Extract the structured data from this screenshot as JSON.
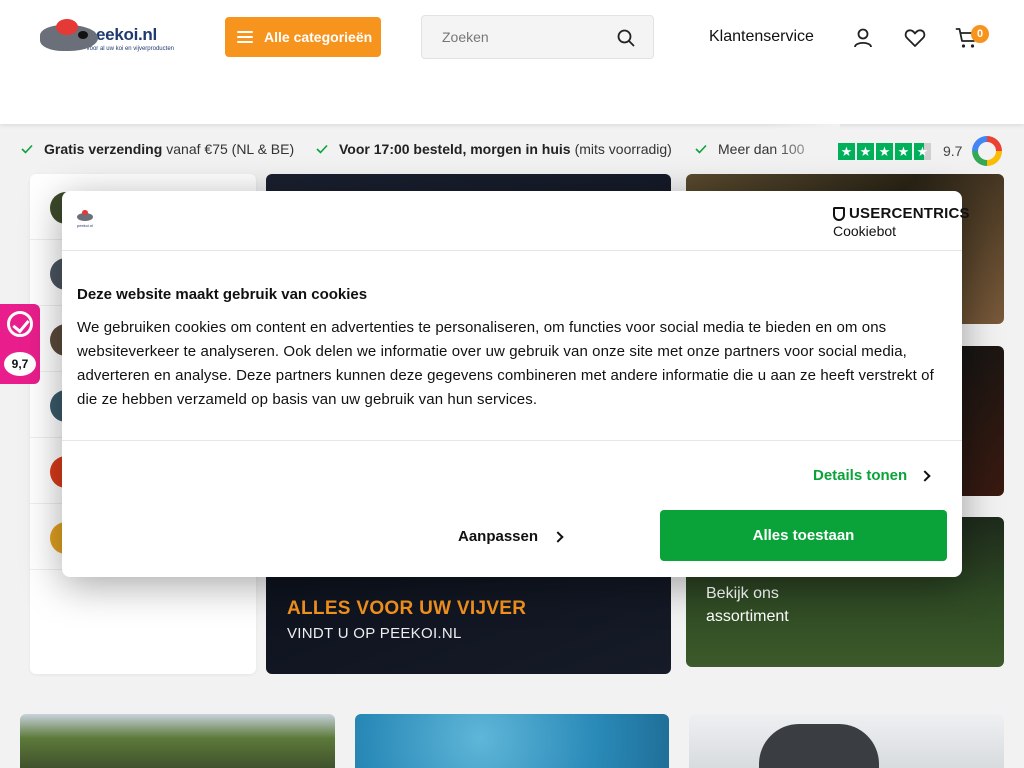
{
  "header": {
    "logo_name": "peekoi.nl",
    "logo_tagline": "Voor al uw koi en vijverproducten",
    "categories_label": "Alle categorieën",
    "search_placeholder": "Zoeken",
    "service_label": "Klantenservice",
    "cart_count": "0"
  },
  "usp": [
    {
      "bold": "Gratis verzending",
      "rest": "vanaf €75 (NL & BE)"
    },
    {
      "bold": "Voor 17:00 besteld, morgen in huis",
      "rest": "(mits voorradig)"
    },
    {
      "bold": "",
      "rest": "Meer dan 100"
    }
  ],
  "rating": {
    "score": "9.7",
    "stars": 4.5
  },
  "review_badge": {
    "score": "9,7"
  },
  "hero": {
    "line1": "ALLES VOOR UW VIJVER",
    "line2": "VINDT U OP PEEKOI.NL"
  },
  "tile3": {
    "line1": "Bekijk ons",
    "line2": "assortiment"
  },
  "cookie": {
    "mini_logo_text": "peekoi.nl",
    "brand_line1": "USERCENTRICS",
    "brand_line2": "Cookiebot",
    "title": "Deze website maakt gebruik van cookies",
    "body": "We gebruiken cookies om content en advertenties te personaliseren, om functies voor social media te bieden en om ons websiteverkeer te analyseren. Ook delen we informatie over uw gebruik van onze site met onze partners voor social media, adverteren en analyse. Deze partners kunnen deze gegevens combineren met andere informatie die u aan ze heeft verstrekt of die ze hebben verzameld op basis van uw gebruik van hun services.",
    "details_label": "Details tonen",
    "customize_label": "Aanpassen",
    "allow_label": "Alles toestaan"
  },
  "colors": {
    "accent": "#f7941d",
    "allow": "#0aa33a",
    "rating": "#00b05a",
    "badge": "#e91e8c"
  }
}
